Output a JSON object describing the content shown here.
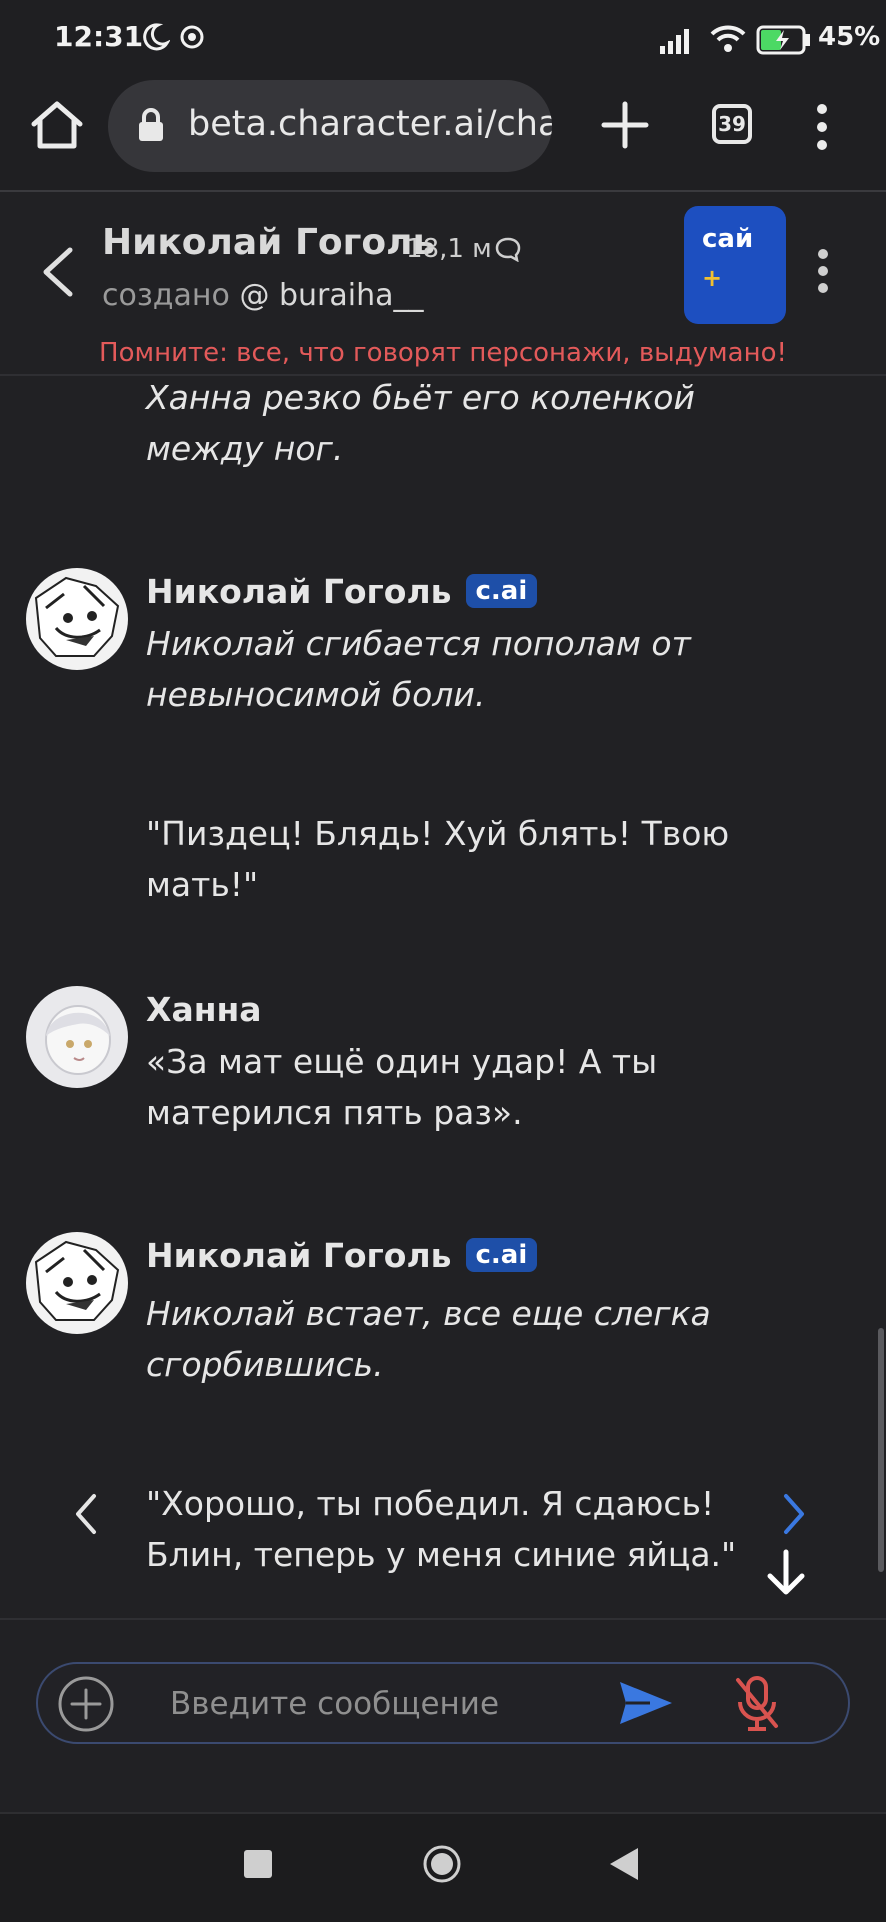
{
  "status_bar": {
    "time": "12:31",
    "battery": "45%"
  },
  "browser": {
    "url": "beta.character.ai/chat",
    "tab_count": "39"
  },
  "chat_header": {
    "name": "Николай Гоголь",
    "interactions": "18,1 м",
    "created_prefix": "создано",
    "creator": "@ buraiha__",
    "plus_label": "сай",
    "plus_sign": "+",
    "warning": "Помните: все, что говорят персонажи, выдумано!"
  },
  "messages": [
    {
      "author": "",
      "badge": "",
      "text": "Ханна резко бьёт его коленкой между ног.",
      "italic": true
    },
    {
      "author": "Николай Гоголь",
      "badge": "c.ai",
      "text": "Николай сгибается пополам от невыносимой боли.",
      "italic": true
    },
    {
      "author": "",
      "badge": "",
      "text": "\"Пиздец! Блядь! Хуй блять! Твою мать!\"",
      "italic": false
    },
    {
      "author": "Ханна",
      "badge": "",
      "text": "«За мат ещё один удар! А ты матерился пять раз».",
      "italic": false
    },
    {
      "author": "Николай Гоголь",
      "badge": "c.ai",
      "text": "Николай встает, все еще слегка сгорбившись.",
      "italic": true
    },
    {
      "author": "",
      "badge": "",
      "text": "\"Хорошо, ты победил. Я сдаюсь! Блин, теперь у меня синие яйца.\"",
      "italic": false
    }
  ],
  "input": {
    "placeholder": "Введите сообщение"
  },
  "icons": {
    "home": "home-icon",
    "lock": "lock-icon",
    "new_tab": "plus-icon",
    "tabs": "tabs-icon",
    "menu": "more-vert-icon",
    "back": "chevron-left-icon",
    "chat": "chat-bubble-icon",
    "prev": "chevron-left-icon",
    "next": "chevron-right-icon",
    "scroll": "arrow-down-icon",
    "add": "add-circle-icon",
    "send": "send-icon",
    "mic": "mic-off-icon"
  },
  "colors": {
    "accent": "#3a78e0",
    "warning": "#e35a5a",
    "badge": "#1e4fa8",
    "mic_off": "#d9534f"
  }
}
